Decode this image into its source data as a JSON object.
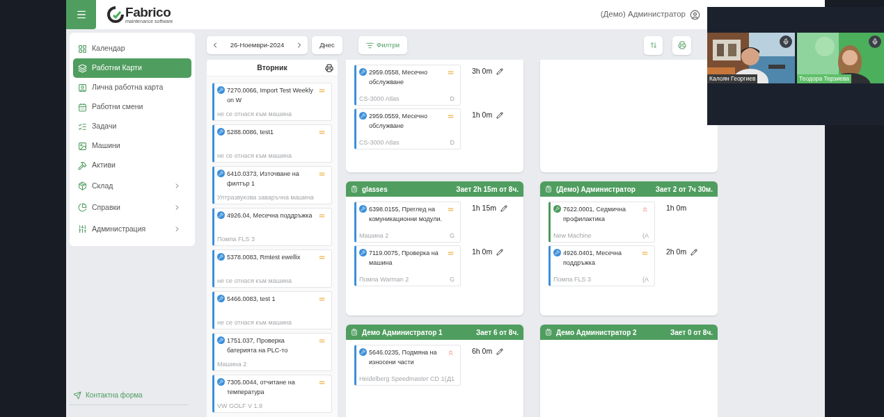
{
  "header": {
    "logo": {
      "name": "Fabrico",
      "tagline": "maintenance software"
    },
    "user": "(Демо) Администратор"
  },
  "sidebar": {
    "items": [
      {
        "label": "Календар",
        "selected": false,
        "expandable": false
      },
      {
        "label": "Работни Карти",
        "selected": true,
        "expandable": false
      },
      {
        "label": "Лична работна карта",
        "selected": false,
        "expandable": false
      },
      {
        "label": "Работни смени",
        "selected": false,
        "expandable": false
      },
      {
        "label": "Задачи",
        "selected": false,
        "expandable": false
      },
      {
        "label": "Машини",
        "selected": false,
        "expandable": false
      },
      {
        "label": "Активи",
        "selected": false,
        "expandable": false
      },
      {
        "label": "Склад",
        "selected": false,
        "expandable": true
      },
      {
        "label": "Справки",
        "selected": false,
        "expandable": true
      },
      {
        "label": "Администрация",
        "selected": false,
        "expandable": true
      }
    ],
    "footer_link": "Контактна форма"
  },
  "toolbar": {
    "date": "26-Ноември-2024",
    "today_button": "Днес",
    "filter_button": "Филтри"
  },
  "day_column": {
    "title": "Вторник",
    "cards": [
      {
        "title": "7270.0066, Import Test Weekly on W",
        "machine": "не се отнася към машина",
        "high_priority": false,
        "color": "#3b8fd9"
      },
      {
        "title": "5288.0086, test1",
        "machine": "не се отнася към машина",
        "high_priority": false,
        "color": "#3b8fd9"
      },
      {
        "title": "6410.0373, Източване на филтър 1",
        "machine": "Ултразвукова заваръчна машина",
        "high_priority": false,
        "color": "#3b8fd9"
      },
      {
        "title": "4926.04, Месечна поддръжка",
        "machine": "Помпа FLS 3",
        "high_priority": false,
        "color": "#3b8fd9"
      },
      {
        "title": "5378.0083, Rmtest ewellix",
        "machine": "не се отнася към машина",
        "high_priority": false,
        "color": "#3b8fd9"
      },
      {
        "title": "5466.0083, test 1",
        "machine": "не се отнася към машина",
        "high_priority": false,
        "color": "#3b8fd9"
      },
      {
        "title": "1751.037, Проверка батерията на PLC-то",
        "machine": "Машина 2",
        "high_priority": false,
        "color": "#3b8fd9"
      },
      {
        "title": "7305.0044, отчитане на температура",
        "machine": "VW GOLF V 1.9",
        "high_priority": false,
        "color": "#3b8fd9"
      }
    ]
  },
  "panels": [
    {
      "header_hidden": true,
      "entries": [
        {
          "title": "2959.0558, Месечно обслужване",
          "machine": "CS-3000 Atlas",
          "code": "D",
          "high_priority": false,
          "color": "#3b8fd9",
          "duration": "3h 0m",
          "editable": true
        },
        {
          "title": "2959.0559, Месечно обслужване",
          "machine": "CS-3000 Atlas",
          "code": "D",
          "high_priority": false,
          "color": "#3b8fd9",
          "duration": "1h 0m",
          "editable": true
        }
      ]
    },
    {
      "header_hidden": true
    },
    {
      "header_hidden": false,
      "header": {
        "name": "glasses",
        "load": "Зает 2h 15m от 8ч."
      },
      "entries": [
        {
          "title": "6398.0155, Преглед на комуникационни модули.",
          "machine": "Машина 2",
          "code": "G",
          "high_priority": false,
          "color": "#3b8fd9",
          "duration": "1h 15m",
          "editable": true
        },
        {
          "title": "7119.0075, Проверка на машина",
          "machine": "Помпа Warman 2",
          "code": "G",
          "high_priority": false,
          "color": "#3b8fd9",
          "duration": "1h 0m",
          "editable": true
        }
      ]
    },
    {
      "header_hidden": false,
      "header": {
        "name": "(Демо) Администратор",
        "load": "Зает 2 от 7ч 30м."
      },
      "entries": [
        {
          "title": "7622.0001, Седмична профилактика",
          "machine": "New Machine",
          "code": "(A",
          "high_priority": true,
          "color": "#4a9a5a",
          "duration": "1h 0m",
          "editable": false
        },
        {
          "title": "4926.0401, Месечна поддръжка",
          "machine": "Помпа FLS 3",
          "code": "(A",
          "high_priority": false,
          "color": "#3b8fd9",
          "duration": "2h 0m",
          "editable": true
        }
      ]
    },
    {
      "header_hidden": false,
      "header": {
        "name": "Демо Администратор 1",
        "load": "Зает 6 от 8ч."
      },
      "entries": [
        {
          "title": "5646.0235, Подмяна на износени части",
          "machine": "Heidelberg Speedmaster CD 1(",
          "code": "Д1",
          "high_priority": true,
          "color": "#3b8fd9",
          "duration": "6h 0m",
          "editable": true
        }
      ]
    },
    {
      "header_hidden": false,
      "header": {
        "name": "Демо Администратор 2",
        "load": "Зает 0 от 8ч."
      }
    }
  ],
  "video_call": {
    "participants": [
      {
        "name": "Калоян Георгиев",
        "kind": "room"
      },
      {
        "name": "Теодора Терзиева",
        "kind": "green"
      }
    ]
  }
}
